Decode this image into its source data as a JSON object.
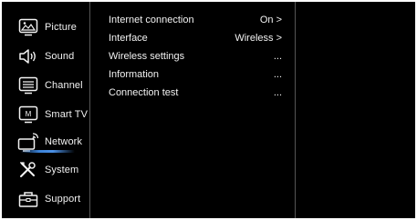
{
  "sidebar": {
    "items": [
      {
        "label": "Picture",
        "icon": "picture-icon"
      },
      {
        "label": "Sound",
        "icon": "speaker-icon"
      },
      {
        "label": "Channel",
        "icon": "channel-icon"
      },
      {
        "label": "Smart TV",
        "icon": "smart-tv-icon"
      },
      {
        "label": "Network",
        "icon": "network-icon",
        "selected": true
      },
      {
        "label": "System",
        "icon": "tools-icon"
      },
      {
        "label": "Support",
        "icon": "toolbox-icon"
      }
    ]
  },
  "network_menu": {
    "rows": [
      {
        "label": "Internet connection",
        "value": "On >"
      },
      {
        "label": "Interface",
        "value": "Wireless >"
      },
      {
        "label": "Wireless settings",
        "value": "..."
      },
      {
        "label": "Information",
        "value": "..."
      },
      {
        "label": "Connection test",
        "value": "..."
      }
    ]
  },
  "colors": {
    "background": "#000000",
    "text": "#f2f2f2",
    "accent": "#3a82d8",
    "divider": "#555555"
  }
}
